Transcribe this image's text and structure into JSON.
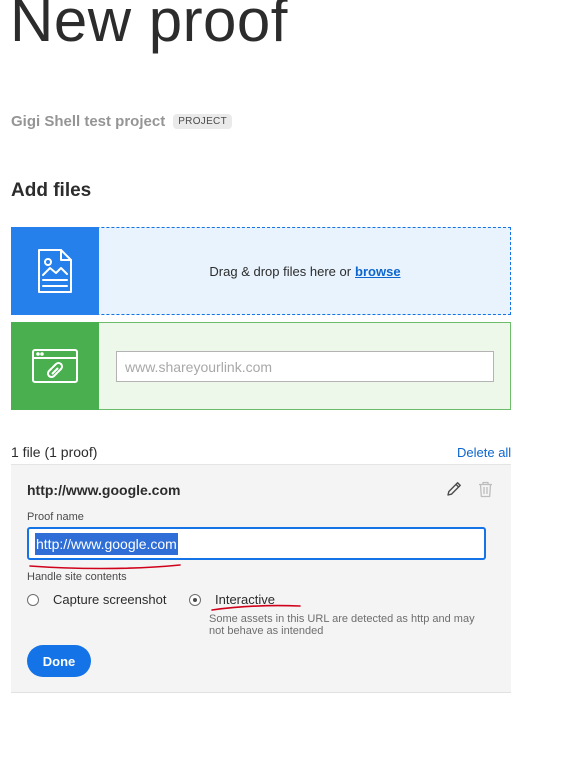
{
  "header": {
    "title": "New proof"
  },
  "project": {
    "name": "Gigi Shell test project",
    "badge": "PROJECT"
  },
  "add_files": {
    "heading": "Add files",
    "drop_text": "Drag & drop files here or",
    "browse_label": "browse",
    "link_placeholder": "www.shareyourlink.com"
  },
  "files": {
    "count_label": "1 file (1 proof)",
    "delete_all_label": "Delete all"
  },
  "proof": {
    "url": "http://www.google.com",
    "name_label": "Proof name",
    "name_value": "http://www.google.com",
    "handle_label": "Handle site contents",
    "options": [
      {
        "label": "Capture screenshot",
        "selected": false
      },
      {
        "label": "Interactive",
        "selected": true
      }
    ],
    "warning": "Some assets in this URL are detected as http and may not behave as intended",
    "done_label": "Done"
  },
  "colors": {
    "accent": "#1473e6",
    "drop_icon_bg": "#2680eb",
    "link_icon_bg": "#4aaf4f",
    "annotation_red": "#d0021b"
  },
  "icons": [
    "file-image-icon",
    "link-browser-icon",
    "pencil-icon",
    "trash-icon"
  ]
}
